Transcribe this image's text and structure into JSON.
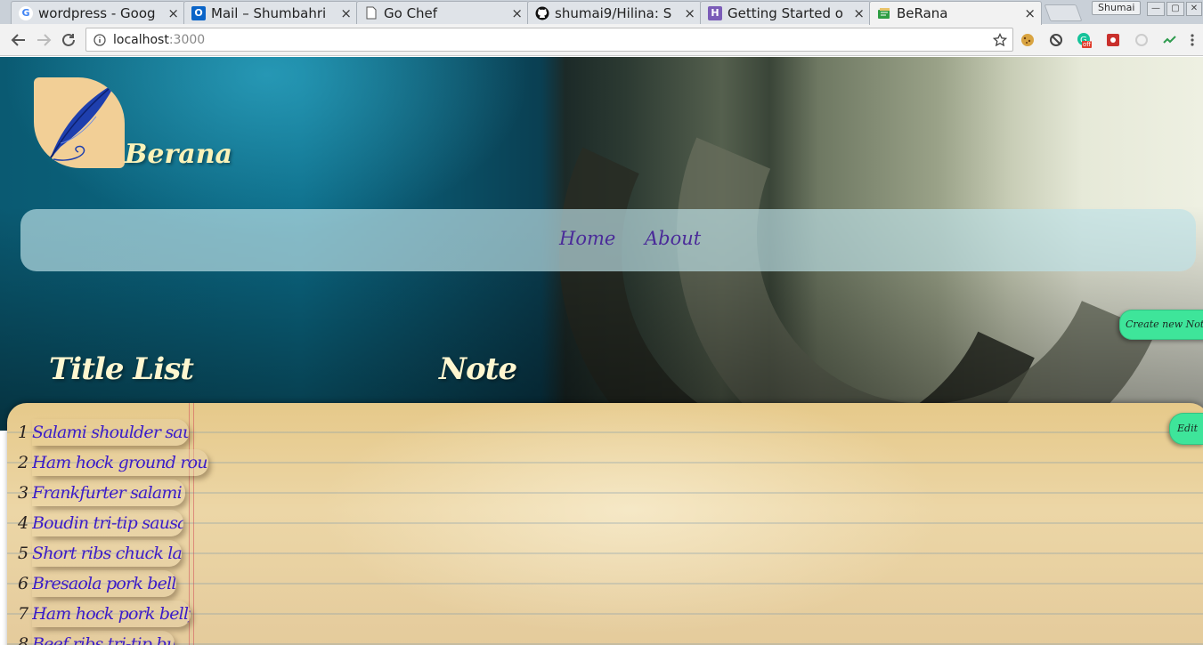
{
  "browser": {
    "tabs": [
      {
        "title": "wordpress - Goog",
        "favicon": "google-icon",
        "active": false
      },
      {
        "title": "Mail – Shumbahri",
        "favicon": "outlook-icon",
        "active": false
      },
      {
        "title": "Go Chef",
        "favicon": "page-icon",
        "active": false
      },
      {
        "title": "shumai9/Hilina: S",
        "favicon": "github-icon",
        "active": false
      },
      {
        "title": "Getting Started o",
        "favicon": "heroku-icon",
        "active": false
      },
      {
        "title": "BeRana",
        "favicon": "notebook-icon",
        "active": true
      }
    ],
    "close_glyph": "×",
    "profile_name": "Shumai",
    "window_buttons": {
      "minimize": "—",
      "maximize": "▢",
      "close": "✕"
    },
    "address": {
      "host": "localhost",
      "port": ":3000"
    },
    "extension_badge": "off"
  },
  "site": {
    "brand": "Berana",
    "nav": {
      "home": "Home",
      "about": "About"
    },
    "create_button": "Create new Note",
    "title_list_heading": "Title List",
    "note_heading": "Note",
    "edit_button": "Edit",
    "titles": [
      {
        "num": "1",
        "text": "Salami shoulder saus"
      },
      {
        "num": "2",
        "text": "Ham hock ground roun"
      },
      {
        "num": "3",
        "text": "Frankfurter salami s"
      },
      {
        "num": "4",
        "text": "Boudin tri-tip sausa"
      },
      {
        "num": "5",
        "text": "Short ribs chuck lan"
      },
      {
        "num": "6",
        "text": "Bresaola pork belly"
      },
      {
        "num": "7",
        "text": "Ham hock pork belly"
      },
      {
        "num": "8",
        "text": "Beef ribs tri-tip bu"
      }
    ]
  }
}
